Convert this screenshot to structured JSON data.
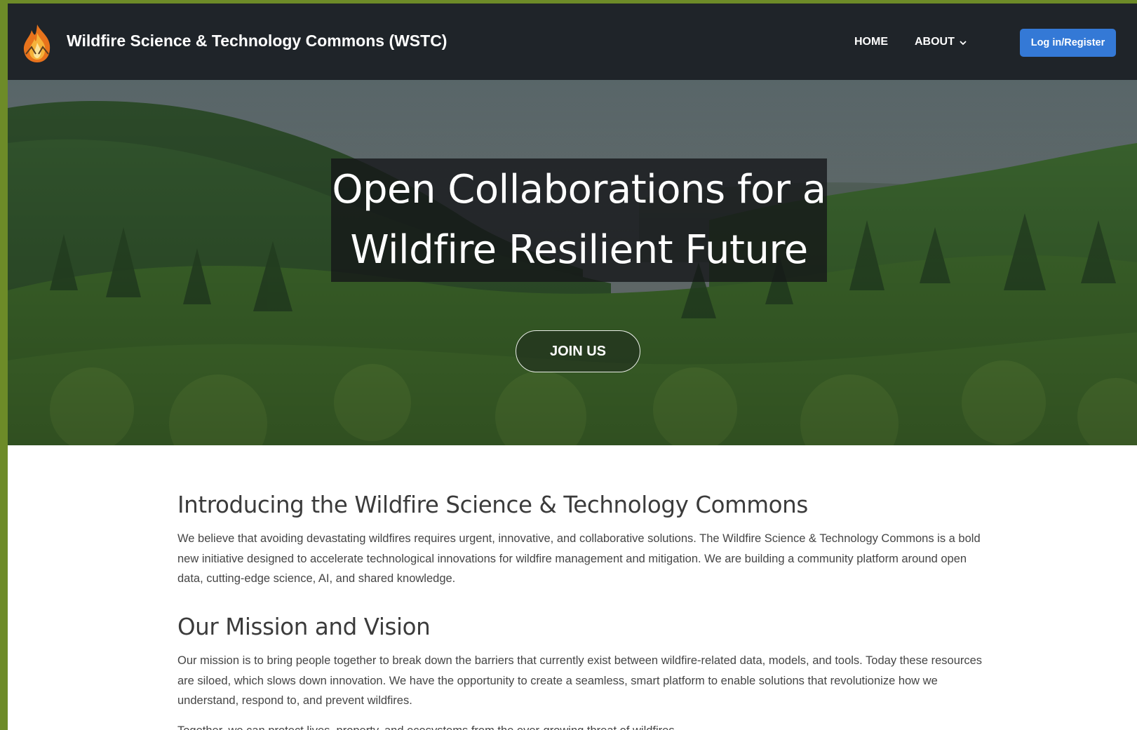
{
  "header": {
    "logo_icon": "flame-logo-icon",
    "brand": "Wildfire Science & Technology Commons (WSTC)",
    "nav": {
      "home": "HOME",
      "about": "ABOUT"
    },
    "login_label": "Log in/Register"
  },
  "hero": {
    "title_line1": "Open Collaborations for a",
    "title_line2": "Wildfire Resilient Future",
    "join_label": "JOIN US"
  },
  "content": {
    "intro_heading": "Introducing the Wildfire Science & Technology Commons",
    "intro_text": "We believe that avoiding devastating wildfires requires urgent, innovative, and collaborative solutions. The Wildfire Science & Technology Commons is a bold new initiative designed to accelerate technological innovations for wildfire management and mitigation. We are building a community platform around open data, cutting-edge science, AI, and shared knowledge.",
    "mission_heading": "Our Mission and Vision",
    "mission_text": "Our mission is to bring people together to break down the barriers that currently exist between wildfire-related data, models, and tools. Today these resources are siloed, which slows down innovation. We have the opportunity to create a seamless, smart platform to enable solutions that revolutionize how we understand, respond to, and prevent wildfires.",
    "together_text": "Together, we can protect lives, property, and ecosystems from the ever-growing threat of wildfires."
  },
  "colors": {
    "navbar": "#1f2429",
    "login_button": "#3479d6",
    "outer_frame": "#6d8b28"
  }
}
